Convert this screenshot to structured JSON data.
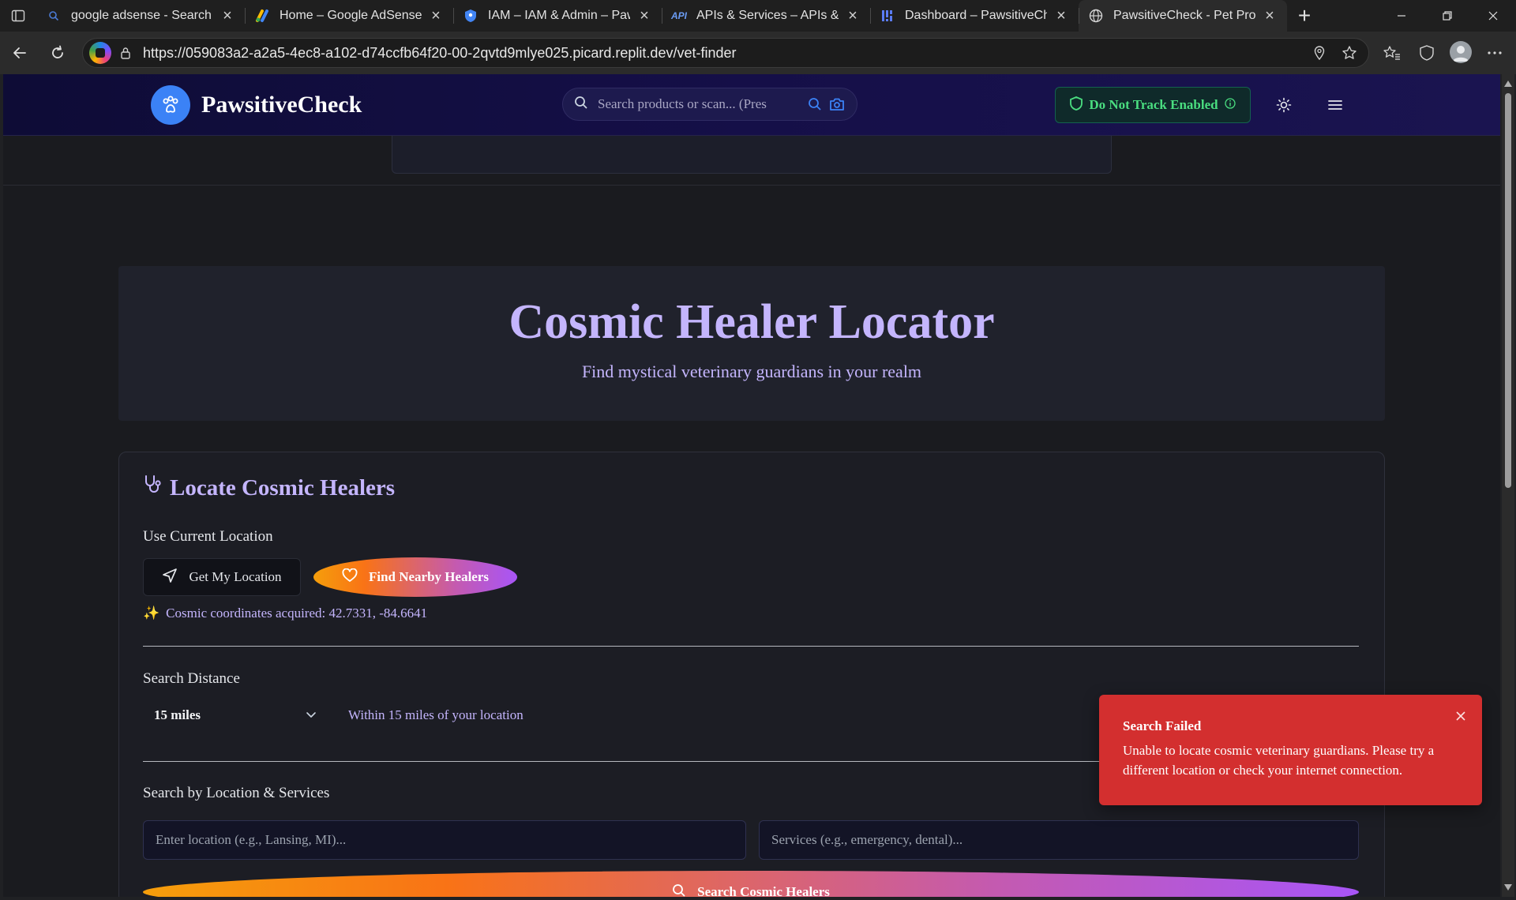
{
  "browser": {
    "tabs": [
      {
        "title": "google adsense - Search",
        "icon": "search-icon"
      },
      {
        "title": "Home – Google AdSense",
        "icon": "adsense-icon"
      },
      {
        "title": "IAM – IAM & Admin – Pawsi",
        "icon": "shield-icon"
      },
      {
        "title": "APIs & Services – APIs & Ser",
        "icon": "api-icon",
        "icon_text": "API"
      },
      {
        "title": "Dashboard – PawsitiveCheck",
        "icon": "dashboard-icon"
      },
      {
        "title": "PawsitiveCheck - Pet Produc",
        "icon": "globe-icon"
      }
    ],
    "url": "https://059083a2-a2a5-4ec8-a102-d74ccfb64f20-00-2qvtd9mlye025.picard.replit.dev/vet-finder"
  },
  "header": {
    "brand": "PawsitiveCheck",
    "search_placeholder": "Search products or scan... (Pres",
    "dnt_label": "Do Not Track Enabled"
  },
  "hero": {
    "title": "Cosmic Healer Locator",
    "subtitle": "Find mystical veterinary guardians in your realm"
  },
  "locate": {
    "title": "Locate Cosmic Healers",
    "current_location_label": "Use Current Location",
    "get_location_button": "Get My Location",
    "find_nearby_button": "Find Nearby Healers",
    "coords_text": "Cosmic coordinates acquired: 42.7331, -84.6641",
    "sparkle": "✨"
  },
  "distance": {
    "label": "Search Distance",
    "selected": "15 miles",
    "hint": "Within 15 miles of your location"
  },
  "search": {
    "label": "Search by Location & Services",
    "location_placeholder": "Enter location (e.g., Lansing, MI)...",
    "services_placeholder": "Services (e.g., emergency, dental)...",
    "button": "Search Cosmic Healers"
  },
  "toast": {
    "title": "Search Failed",
    "message": "Unable to locate cosmic veterinary guardians. Please try a different location or check your internet connection."
  },
  "colors": {
    "accent": "#c4b5fd",
    "brand_blue": "#3b82f6",
    "dnt_green": "#4ade80",
    "toast_red": "#d32f2f"
  }
}
